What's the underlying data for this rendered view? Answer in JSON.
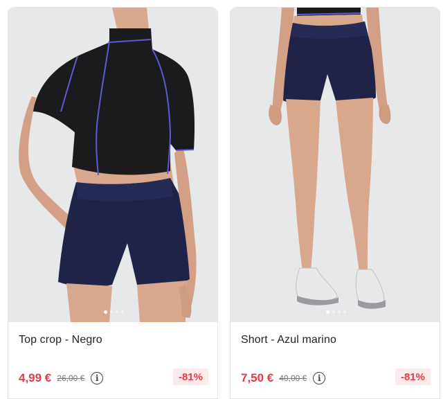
{
  "products": [
    {
      "name": "Top crop - Negro",
      "price": "4,99 €",
      "old_price": "26,00 €",
      "discount": "-81%",
      "info_icon": "info-icon",
      "carousel_total": 4,
      "carousel_active": 1
    },
    {
      "name": "Short - Azul marino",
      "price": "7,50 €",
      "old_price": "40,00 €",
      "discount": "-81%",
      "info_icon": "info-icon",
      "carousel_total": 4,
      "carousel_active": 1
    }
  ],
  "colors": {
    "price": "#e63946",
    "discount_bg": "#fdeaea",
    "photo_bg": "#e7e8ea",
    "top_black": "#1b1b1d",
    "shorts_navy": "#1f2348",
    "piping": "#5b5bd6"
  }
}
